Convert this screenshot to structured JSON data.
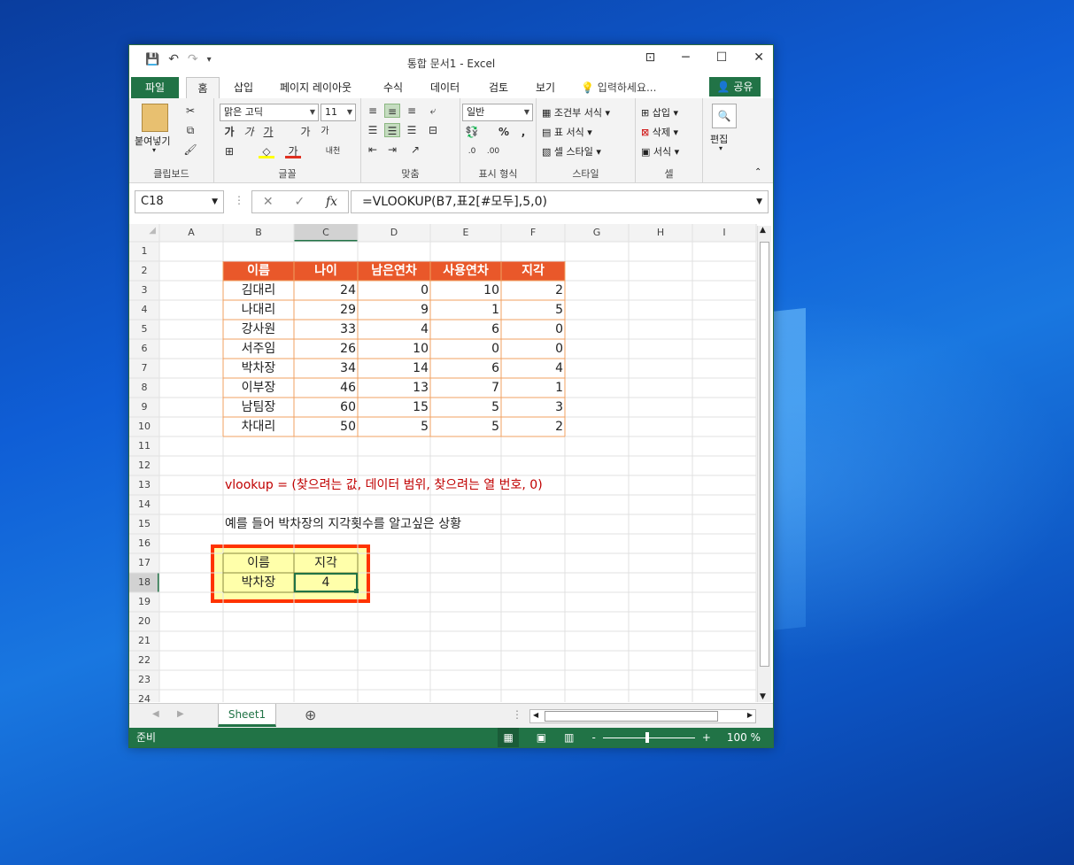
{
  "window": {
    "title": "통합 문서1 - Excel",
    "minimize": "─",
    "maximize": "☐",
    "close": "✕",
    "ribbon_display": "⊡"
  },
  "qat": {
    "save": "💾",
    "undo": "↶",
    "redo": "↷",
    "customize": "▾"
  },
  "tabs": [
    {
      "label": "파일"
    },
    {
      "label": "홈"
    },
    {
      "label": "삽입"
    },
    {
      "label": "페이지 레이아웃"
    },
    {
      "label": "수식"
    },
    {
      "label": "데이터"
    },
    {
      "label": "검토"
    },
    {
      "label": "보기"
    }
  ],
  "tell_me": "입력하세요...",
  "share": "공유",
  "ribbon": {
    "clipboard": {
      "paste": "붙여넣기",
      "label": "클립보드"
    },
    "font": {
      "name": "맑은 고딕",
      "size": "11",
      "label": "글꼴",
      "bold": "가",
      "italic": "가",
      "underline": "가",
      "grow": "가",
      "shrink": "가",
      "phonetic": "내천"
    },
    "alignment": {
      "label": "맞춤"
    },
    "number": {
      "format": "일반",
      "label": "표시 형식",
      "percent": "%",
      "comma": ","
    },
    "styles": {
      "conditional": "조건부 서식",
      "table": "표 서식",
      "cell": "셀 스타일",
      "label": "스타일"
    },
    "cells": {
      "insert": "삽입",
      "delete": "삭제",
      "format": "서식",
      "label": "셀"
    },
    "editing": {
      "label": "편집"
    }
  },
  "formula_bar": {
    "name_box": "C18",
    "formula": "=VLOOKUP(B7,표2[#모두],5,0)",
    "cancel": "✕",
    "enter": "✓",
    "fx": "fx"
  },
  "columns": [
    "A",
    "B",
    "C",
    "D",
    "E",
    "F",
    "G",
    "H",
    "I"
  ],
  "rows": [
    "1",
    "2",
    "3",
    "4",
    "5",
    "6",
    "7",
    "8",
    "9",
    "10",
    "11",
    "12",
    "13",
    "14",
    "15",
    "16",
    "17",
    "18",
    "19",
    "20",
    "21",
    "22",
    "23",
    "24"
  ],
  "table": {
    "headers": [
      "이름",
      "나이",
      "남은연차",
      "사용연차",
      "지각"
    ],
    "rows": [
      {
        "name": "김대리",
        "age": "24",
        "remain": "0",
        "used": "10",
        "late": "2"
      },
      {
        "name": "나대리",
        "age": "29",
        "remain": "9",
        "used": "1",
        "late": "5"
      },
      {
        "name": "강사원",
        "age": "33",
        "remain": "4",
        "used": "6",
        "late": "0"
      },
      {
        "name": "서주임",
        "age": "26",
        "remain": "10",
        "used": "0",
        "late": "0"
      },
      {
        "name": "박차장",
        "age": "34",
        "remain": "14",
        "used": "6",
        "late": "4"
      },
      {
        "name": "이부장",
        "age": "46",
        "remain": "13",
        "used": "7",
        "late": "1"
      },
      {
        "name": "남팀장",
        "age": "60",
        "remain": "15",
        "used": "5",
        "late": "3"
      },
      {
        "name": "차대리",
        "age": "50",
        "remain": "5",
        "used": "5",
        "late": "2"
      }
    ]
  },
  "note_vlookup": "vlookup = (찾으려는 값, 데이터 범위, 찾으려는 열 번호, 0)",
  "note_example": "예를 들어 박차장의 지각횟수를 알고싶은 상황",
  "lookup": {
    "header_name": "이름",
    "header_late": "지각",
    "name": "박차장",
    "result": "4"
  },
  "sheet_tab": "Sheet1",
  "add_sheet": "⊕",
  "status": {
    "ready": "준비",
    "zoom": "100 %",
    "zoom_out": "-",
    "zoom_in": "+"
  },
  "colors": {
    "excel_green": "#217346",
    "table_header": "#e9582a",
    "table_border": "#f0a060",
    "note_red": "#c00000",
    "lookup_fill": "#ffffaa",
    "highlight_border": "#ff3300"
  }
}
